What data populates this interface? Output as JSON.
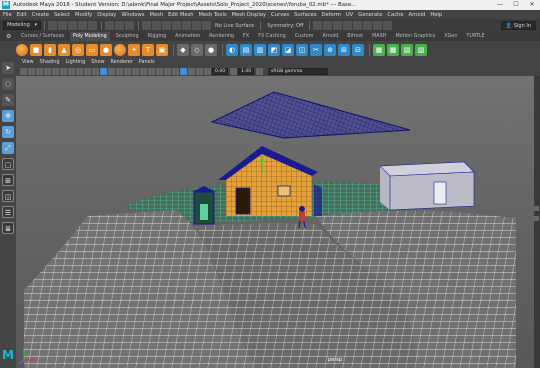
{
  "window": {
    "title": "Autodesk Maya 2018 - Student Version: D:\\abmk\\Final Major Project\\Assets\\Solo_Project_2020\\scenes\\Yoruba_02.mb* --- Base...",
    "minimize": "—",
    "maximize": "☐",
    "close": "✕"
  },
  "menubar": [
    "File",
    "Edit",
    "Create",
    "Select",
    "Modify",
    "Display",
    "Windows",
    "Mesh",
    "Edit Mesh",
    "Mesh Tools",
    "Mesh Display",
    "Curves",
    "Surfaces",
    "Deform",
    "UV",
    "Generate",
    "Cache",
    "Arnold",
    "Help"
  ],
  "statusline": {
    "menuset": "Modeling",
    "live_surface": "No Live Surface",
    "symmetry": "Symmetry: Off",
    "sign_in": "Sign In"
  },
  "shelf_tabs": [
    "Curves / Surfaces",
    "Poly Modeling",
    "Sculpting",
    "Rigging",
    "Animation",
    "Rendering",
    "FX",
    "FX Caching",
    "Custom",
    "Arnold",
    "Bifrost",
    "MASH",
    "Motion Graphics",
    "XGen",
    "TURTLE"
  ],
  "active_shelf_tab": "Poly Modeling",
  "panel_menu": [
    "View",
    "Shading",
    "Lighting",
    "Show",
    "Renderer",
    "Panels"
  ],
  "panel_toolbar": {
    "value_a": "0.00",
    "value_b": "1.00",
    "color_space": "sRGB gamma"
  },
  "viewport": {
    "camera": "persp"
  },
  "colors": {
    "wireframe_terrain": "#ffffff",
    "wireframe_selected": "#4fe3a8",
    "wireframe_object": "#1b1b8f",
    "house_wall": "#e6a23a",
    "viewport_bg": "#6b6b6b",
    "accent": "#e88b2a"
  }
}
